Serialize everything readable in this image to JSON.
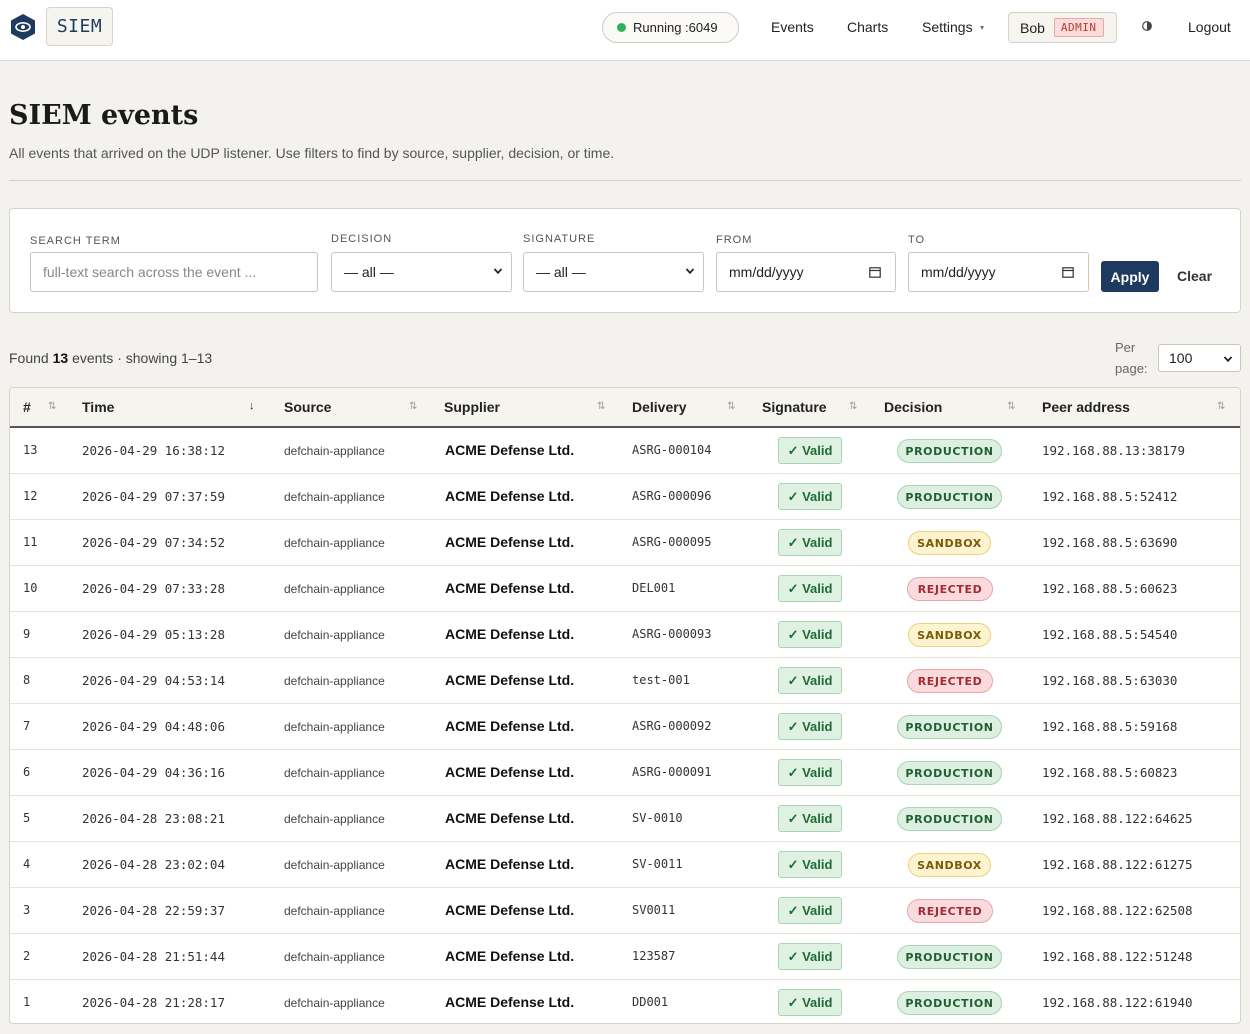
{
  "topbar": {
    "brand": "SIEM",
    "status": "Running :6049",
    "status_color": "#2fb35a",
    "nav": {
      "events": "Events",
      "charts": "Charts",
      "settings": "Settings"
    },
    "user": {
      "name": "Bob",
      "role": "ADMIN"
    },
    "logout": "Logout"
  },
  "header": {
    "title": "SIEM events",
    "subtitle": "All events that arrived on the UDP listener. Use filters to find by source, supplier, decision, or time."
  },
  "filters": {
    "search": {
      "label": "Search term",
      "placeholder": "full-text search across the event ..."
    },
    "decision": {
      "label": "Decision",
      "value": "— all —"
    },
    "signature": {
      "label": "Signature",
      "value": "— all —"
    },
    "from": {
      "label": "From",
      "value": "mm/dd/yyyy"
    },
    "to": {
      "label": "To",
      "value": "mm/dd/yyyy"
    },
    "apply": "Apply",
    "clear": "Clear"
  },
  "results": {
    "found_prefix": "Found",
    "count": "13",
    "found_suffix": "events · showing 1–13",
    "per_page_label": "Per page:",
    "per_page": "100"
  },
  "table": {
    "columns": [
      "#",
      "Time",
      "Source",
      "Supplier",
      "Delivery",
      "Signature",
      "Decision",
      "Peer address"
    ],
    "rows": [
      {
        "num": "13",
        "time": "2026-04-29 16:38:12",
        "source": "defchain-appliance",
        "supplier": "ACME Defense Ltd.",
        "delivery": "ASRG-000104",
        "signature": "✓ Valid",
        "decision": "PRODUCTION",
        "peer": "192.168.88.13:38179"
      },
      {
        "num": "12",
        "time": "2026-04-29 07:37:59",
        "source": "defchain-appliance",
        "supplier": "ACME Defense Ltd.",
        "delivery": "ASRG-000096",
        "signature": "✓ Valid",
        "decision": "PRODUCTION",
        "peer": "192.168.88.5:52412"
      },
      {
        "num": "11",
        "time": "2026-04-29 07:34:52",
        "source": "defchain-appliance",
        "supplier": "ACME Defense Ltd.",
        "delivery": "ASRG-000095",
        "signature": "✓ Valid",
        "decision": "SANDBOX",
        "peer": "192.168.88.5:63690"
      },
      {
        "num": "10",
        "time": "2026-04-29 07:33:28",
        "source": "defchain-appliance",
        "supplier": "ACME Defense Ltd.",
        "delivery": "DEL001",
        "signature": "✓ Valid",
        "decision": "REJECTED",
        "peer": "192.168.88.5:60623"
      },
      {
        "num": "9",
        "time": "2026-04-29 05:13:28",
        "source": "defchain-appliance",
        "supplier": "ACME Defense Ltd.",
        "delivery": "ASRG-000093",
        "signature": "✓ Valid",
        "decision": "SANDBOX",
        "peer": "192.168.88.5:54540"
      },
      {
        "num": "8",
        "time": "2026-04-29 04:53:14",
        "source": "defchain-appliance",
        "supplier": "ACME Defense Ltd.",
        "delivery": "test-001",
        "signature": "✓ Valid",
        "decision": "REJECTED",
        "peer": "192.168.88.5:63030"
      },
      {
        "num": "7",
        "time": "2026-04-29 04:48:06",
        "source": "defchain-appliance",
        "supplier": "ACME Defense Ltd.",
        "delivery": "ASRG-000092",
        "signature": "✓ Valid",
        "decision": "PRODUCTION",
        "peer": "192.168.88.5:59168"
      },
      {
        "num": "6",
        "time": "2026-04-29 04:36:16",
        "source": "defchain-appliance",
        "supplier": "ACME Defense Ltd.",
        "delivery": "ASRG-000091",
        "signature": "✓ Valid",
        "decision": "PRODUCTION",
        "peer": "192.168.88.5:60823"
      },
      {
        "num": "5",
        "time": "2026-04-28 23:08:21",
        "source": "defchain-appliance",
        "supplier": "ACME Defense Ltd.",
        "delivery": "SV-0010",
        "signature": "✓ Valid",
        "decision": "PRODUCTION",
        "peer": "192.168.88.122:64625"
      },
      {
        "num": "4",
        "time": "2026-04-28 23:02:04",
        "source": "defchain-appliance",
        "supplier": "ACME Defense Ltd.",
        "delivery": "SV-0011",
        "signature": "✓ Valid",
        "decision": "SANDBOX",
        "peer": "192.168.88.122:61275"
      },
      {
        "num": "3",
        "time": "2026-04-28 22:59:37",
        "source": "defchain-appliance",
        "supplier": "ACME Defense Ltd.",
        "delivery": "SV0011",
        "signature": "✓ Valid",
        "decision": "REJECTED",
        "peer": "192.168.88.122:62508"
      },
      {
        "num": "2",
        "time": "2026-04-28 21:51:44",
        "source": "defchain-appliance",
        "supplier": "ACME Defense Ltd.",
        "delivery": "123587",
        "signature": "✓ Valid",
        "decision": "PRODUCTION",
        "peer": "192.168.88.122:51248"
      },
      {
        "num": "1",
        "time": "2026-04-28 21:28:17",
        "source": "defchain-appliance",
        "supplier": "ACME Defense Ltd.",
        "delivery": "DD001",
        "signature": "✓ Valid",
        "decision": "PRODUCTION",
        "peer": "192.168.88.122:61940"
      }
    ]
  },
  "colors": {
    "brand": "#1e3a5f",
    "production": "#1f5f33",
    "sandbox": "#7a5b08",
    "rejected": "#a42a33",
    "valid": "#1f6b33"
  },
  "icons": [
    "eye-logo-icon",
    "chevron-down-icon",
    "calendar-icon",
    "theme-toggle-icon",
    "sort-icon",
    "sort-desc-icon"
  ]
}
